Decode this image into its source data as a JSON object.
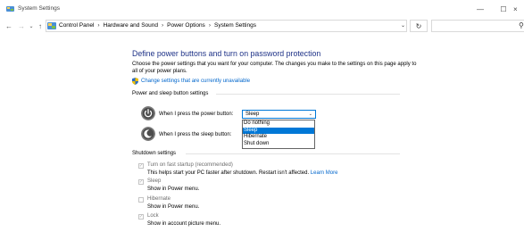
{
  "window": {
    "title": "System Settings",
    "minimize_glyph": "—",
    "maximize_glyph": "☐",
    "close_glyph": "×"
  },
  "address_bar": {
    "crumbs": [
      "Control Panel",
      "Hardware and Sound",
      "Power Options",
      "System Settings"
    ],
    "separator": "›",
    "search_placeholder": ""
  },
  "content": {
    "title": "Define power buttons and turn on password protection",
    "intro": "Choose the power settings that you want for your computer. The changes you make to the settings on this page apply to all of your power plans.",
    "change_link": "Change settings that are currently unavailable",
    "power_sleep_section": {
      "title": "Power and sleep button settings",
      "power_button_label": "When I press the power button:",
      "power_button_value": "Sleep",
      "sleep_button_label": "When I press the sleep button:",
      "dropdown_options": [
        "Do nothing",
        "Sleep",
        "Hibernate",
        "Shut down"
      ],
      "selected_option": "Sleep"
    },
    "shutdown_section": {
      "title": "Shutdown settings",
      "items": [
        {
          "label": "Turn on fast startup (recommended)",
          "checked": true,
          "desc": "This helps start your PC faster after shutdown. Restart isn't affected. ",
          "link": "Learn More"
        },
        {
          "label": "Sleep",
          "checked": true,
          "desc": "Show in Power menu.",
          "link": ""
        },
        {
          "label": "Hibernate",
          "checked": false,
          "desc": "Show in Power menu.",
          "link": ""
        },
        {
          "label": "Lock",
          "checked": true,
          "desc": "Show in account picture menu.",
          "link": ""
        }
      ]
    }
  },
  "colors": {
    "title_blue": "#1e3287",
    "link_blue": "#0066cc",
    "selection_blue": "#0078d7",
    "disabled_text": "#6d6d6d"
  },
  "icons": {
    "app": "control-panel-icon",
    "shield": "uac-shield-icon",
    "power": "power-icon",
    "sleep": "moon-icon",
    "search": "search-icon",
    "refresh": "refresh-icon"
  }
}
